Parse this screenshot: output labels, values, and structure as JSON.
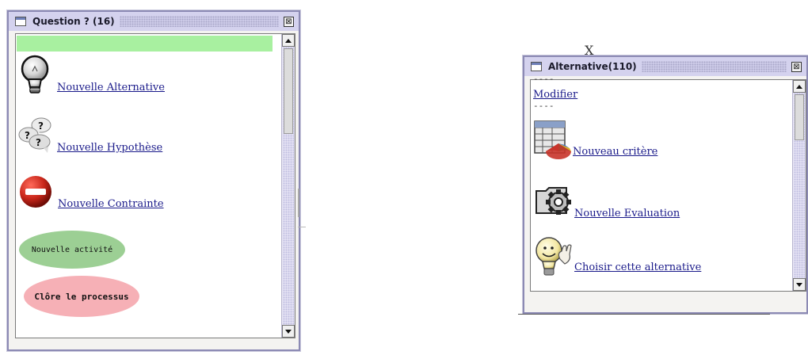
{
  "window_question": {
    "title": "Question ? (16)",
    "close_glyph": "⊠",
    "items": [
      {
        "label": "Nouvelle Alternative",
        "icon": "lightbulb-icon"
      },
      {
        "label": "Nouvelle Hypothèse",
        "icon": "question-bubbles-icon"
      },
      {
        "label": "Nouvelle Contrainte",
        "icon": "stop-sign-icon"
      }
    ],
    "activity_button": "Nouvelle activité",
    "close_process_button": "Clôre le processus",
    "colors": {
      "highlight": "#a8f0a0",
      "activity": "#9ccf94",
      "close_process": "#f6b0b6"
    }
  },
  "window_alternative": {
    "title": "Alternative(110)",
    "close_glyph": "⊠",
    "separator_top": "----",
    "modify_link": "Modifier",
    "separator_mid": "----",
    "items": [
      {
        "label": "Nouveau critère",
        "icon": "chart-table-icon"
      },
      {
        "label": "Nouvelle Evaluation",
        "icon": "gear-folder-icon"
      },
      {
        "label": "Choisir cette alternative",
        "icon": "smiling-bulb-icon"
      }
    ]
  },
  "stray_glyph": "X"
}
